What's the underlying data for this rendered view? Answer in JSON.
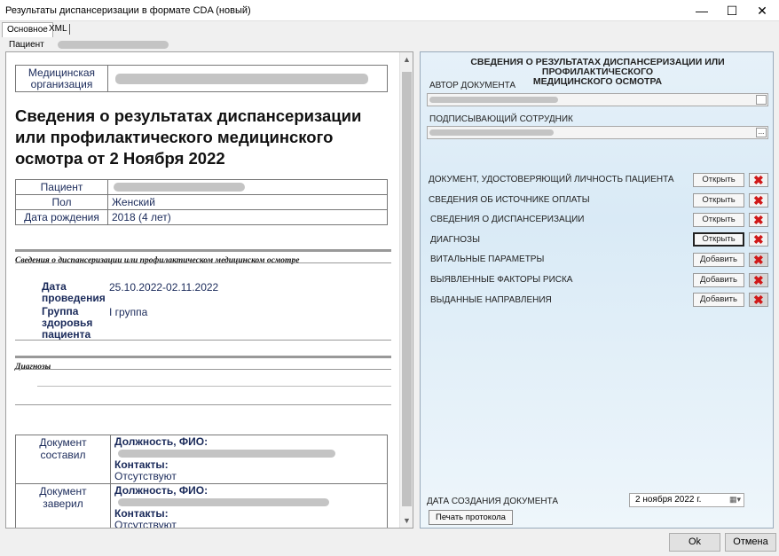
{
  "window": {
    "title": "Результаты диспансеризации в формате CDA (новый)"
  },
  "tabs": [
    "Основное",
    "XML"
  ],
  "patient_label": "Пациент",
  "doc": {
    "org_label_1": "Медицинская",
    "org_label_2": "организация",
    "title": "Сведения о результатах диспансеризации или профилактического медицинского осмотра от 2 Ноября 2022",
    "patient_label": "Пациент",
    "sex_label": "Пол",
    "sex_value": "Женский",
    "dob_label": "Дата рождения",
    "dob_value": "2018 (4 лет)",
    "section1": "Сведения о диспансеризации или профилактическом медицинском осмотре",
    "date_label_1": "Дата",
    "date_label_2": "проведения",
    "date_value": "25.10.2022-02.11.2022",
    "group_label_1": "Группа",
    "group_label_2": "здоровья",
    "group_label_3": "пациента",
    "group_value": "I группа",
    "section2": "Диагнозы",
    "composed_label": "Документ составил",
    "certified_label": "Документ заверил",
    "position_label": "Должность, ФИО:",
    "contacts_label": "Контакты:",
    "contacts_value": "Отсутствуют"
  },
  "panel": {
    "heading_1": "СВЕДЕНИЯ О РЕЗУЛЬТАТАХ ДИСПАНСЕРИЗАЦИИ ИЛИ ПРОФИЛАКТИЧЕСКОГО",
    "heading_2": "МЕДИЦИНСКОГО ОСМОТРА",
    "author_label": "АВТОР ДОКУМЕНТА",
    "signer_label": "ПОДПИСЫВАЮЩИЙ СОТРУДНИК",
    "dots": "...",
    "rows": [
      {
        "label": "ДОКУМЕНТ, УДОСТОВЕРЯЮЩИЙ ЛИЧНОСТЬ ПАЦИЕНТА",
        "button": "Открыть"
      },
      {
        "label": "СВЕДЕНИЯ ОБ ИСТОЧНИКЕ ОПЛАТЫ",
        "button": "Открыть"
      },
      {
        "label": "СВЕДЕНИЯ О ДИСПАНСЕРИЗАЦИИ",
        "button": "Открыть"
      },
      {
        "label": "ДИАГНОЗЫ",
        "button": "Открыть"
      },
      {
        "label": "ВИТАЛЬНЫЕ ПАРАМЕТРЫ",
        "button": "Добавить"
      },
      {
        "label": "ВЫЯВЛЕННЫЕ ФАКТОРЫ РИСКА",
        "button": "Добавить"
      },
      {
        "label": "ВЫДАННЫЕ НАПРАВЛЕНИЯ",
        "button": "Добавить"
      }
    ],
    "creation_date_label": "ДАТА СОЗДАНИЯ ДОКУМЕНТА",
    "creation_date_value": "2  ноября   2022 г.",
    "print_button": "Печать протокола"
  },
  "footer": {
    "ok": "Ok",
    "cancel": "Отмена"
  }
}
